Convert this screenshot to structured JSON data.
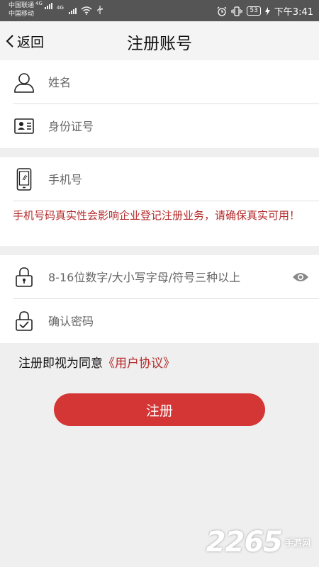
{
  "status_bar": {
    "carrier_1": "中国联通",
    "carrier_1_net": "4G",
    "carrier_2": "中国移动",
    "carrier_2_net": "4G",
    "battery": "53",
    "time": "下午3:41"
  },
  "nav": {
    "back_label": "返回",
    "title": "注册账号"
  },
  "form": {
    "name_placeholder": "姓名",
    "id_placeholder": "身份证号",
    "phone_placeholder": "手机号",
    "phone_warning": "手机号码真实性会影响企业登记注册业务，请确保真实可用！",
    "password_placeholder": "8-16位数字/大小写字母/符号三种以上",
    "confirm_placeholder": "确认密码"
  },
  "agreement": {
    "prefix": "注册即视为同意",
    "link": "《用户协议》"
  },
  "register_label": "注册",
  "watermark": {
    "number": "2265",
    "text": "手游网"
  },
  "colors": {
    "accent": "#d43636",
    "warning_text": "#b52a2a",
    "status_bar_bg": "#555555"
  }
}
